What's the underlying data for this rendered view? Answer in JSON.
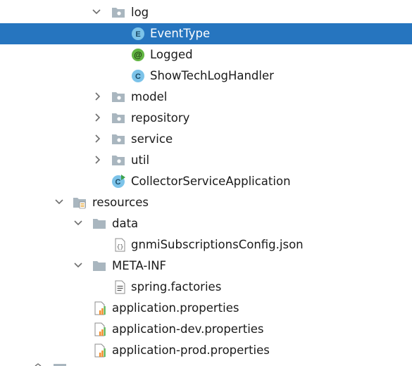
{
  "tree": {
    "items": [
      {
        "label": "log",
        "icon": "package-folder-icon",
        "expanded": true
      },
      {
        "label": "EventType",
        "icon": "enum-class-icon",
        "badge": "E",
        "selected": true
      },
      {
        "label": "Logged",
        "icon": "annotation-icon",
        "badge": "@"
      },
      {
        "label": "ShowTechLogHandler",
        "icon": "java-class-icon",
        "badge": "C"
      },
      {
        "label": "model",
        "icon": "package-folder-icon",
        "expanded": false
      },
      {
        "label": "repository",
        "icon": "package-folder-icon",
        "expanded": false
      },
      {
        "label": "service",
        "icon": "package-folder-icon",
        "expanded": false
      },
      {
        "label": "util",
        "icon": "package-folder-icon",
        "expanded": false
      },
      {
        "label": "CollectorServiceApplication",
        "icon": "spring-boot-app-icon",
        "badge": "C"
      },
      {
        "label": "resources",
        "icon": "resources-root-folder-icon",
        "expanded": true
      },
      {
        "label": "data",
        "icon": "folder-icon",
        "expanded": true
      },
      {
        "label": "gnmiSubscriptionsConfig.json",
        "icon": "json-file-icon",
        "badge": "{}"
      },
      {
        "label": "META-INF",
        "icon": "folder-icon",
        "expanded": true
      },
      {
        "label": "spring.factories",
        "icon": "text-file-icon"
      },
      {
        "label": "application.properties",
        "icon": "properties-file-icon"
      },
      {
        "label": "application-dev.properties",
        "icon": "properties-file-icon"
      },
      {
        "label": "application-prod.properties",
        "icon": "properties-file-icon"
      }
    ]
  },
  "colors": {
    "selection": "#2675bf",
    "class_icon": "#7cc3e9",
    "enum_icon": "#7cc3e9",
    "annotation_icon": "#62b543",
    "spring_green": "#6ab04c",
    "folder": "#9aa7b0",
    "chart_orange": "#f28c28",
    "chart_green": "#5fb85a"
  }
}
